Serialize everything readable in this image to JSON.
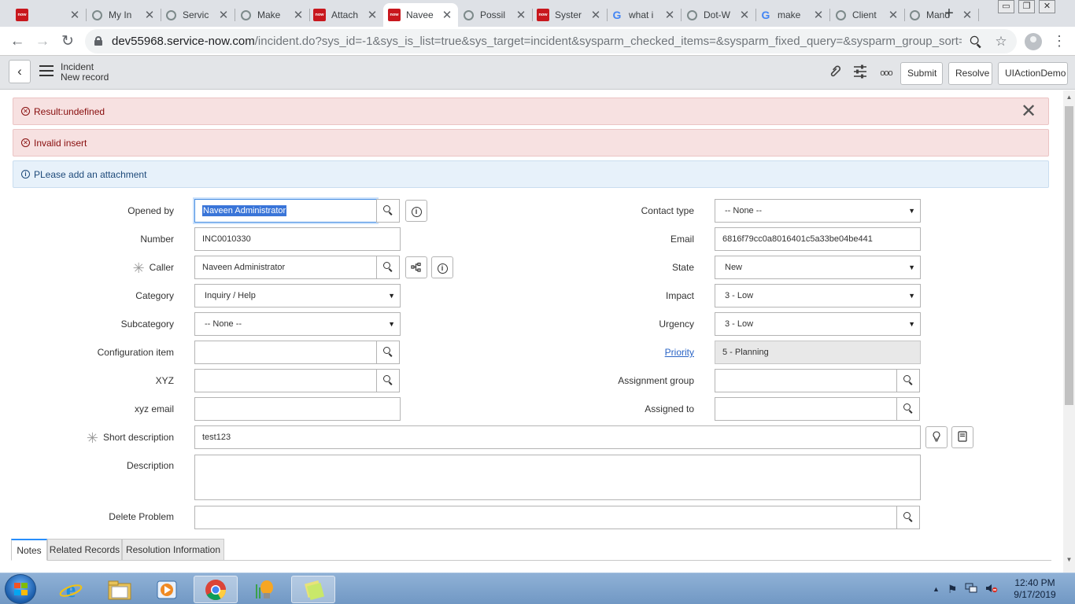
{
  "browser": {
    "tabs": [
      {
        "favicon": "now",
        "title": "",
        "active": false
      },
      {
        "favicon": "servicenow",
        "title": "My In",
        "active": false
      },
      {
        "favicon": "servicenow",
        "title": "Servic",
        "active": false
      },
      {
        "favicon": "servicenow",
        "title": "Make",
        "active": false
      },
      {
        "favicon": "now",
        "title": "Attach",
        "active": false
      },
      {
        "favicon": "now",
        "title": "Navee",
        "active": true
      },
      {
        "favicon": "servicenow",
        "title": "Possil",
        "active": false
      },
      {
        "favicon": "now",
        "title": "Syster",
        "active": false
      },
      {
        "favicon": "google",
        "title": "what i",
        "active": false
      },
      {
        "favicon": "servicenow",
        "title": "Dot-W",
        "active": false
      },
      {
        "favicon": "google",
        "title": "make",
        "active": false
      },
      {
        "favicon": "servicenow",
        "title": "Client",
        "active": false
      },
      {
        "favicon": "servicenow",
        "title": "Mand",
        "active": false
      }
    ],
    "favicon_now_text": "now",
    "new_tab_symbol": "+",
    "close_symbol": "✕",
    "window_buttons": [
      "▭",
      "❐",
      "✕"
    ],
    "url_host": "dev55968.service-now.com",
    "url_path": "/incident.do?sys_id=-1&sys_is_list=true&sys_target=incident&sysparm_checked_items=&sysparm_fixed_query=&sysparm_group_sort=&sysparm...",
    "nav_icons": {
      "back": "←",
      "forward": "→",
      "reload": "↻",
      "zoom": "zoom-icon",
      "star": "☆",
      "menu": "⋮"
    }
  },
  "header": {
    "back_symbol": "‹",
    "title": "Incident",
    "subtitle": "New record",
    "buttons": [
      "Submit",
      "Resolve",
      "UIActionDemo"
    ],
    "icons": {
      "attachment": "📎",
      "settings": "☰",
      "more": "ooo"
    }
  },
  "alerts": [
    {
      "type": "error",
      "text": "Result:undefined"
    },
    {
      "type": "error",
      "text": "Invalid insert"
    },
    {
      "type": "info",
      "text": "PLease add an attachment"
    }
  ],
  "alert_icons": {
    "error": "✕",
    "info": "i",
    "close": "✕"
  },
  "form": {
    "opened_by": {
      "label": "Opened by",
      "value": "Naveen Administrator"
    },
    "number": {
      "label": "Number",
      "value": "INC0010330"
    },
    "caller": {
      "label": "Caller",
      "value": "Naveen Administrator",
      "mandatory_mark": "✳"
    },
    "category": {
      "label": "Category",
      "value": "Inquiry / Help"
    },
    "subcategory": {
      "label": "Subcategory",
      "value": "-- None --"
    },
    "configuration_item": {
      "label": "Configuration item",
      "value": ""
    },
    "xyz": {
      "label": "XYZ",
      "value": ""
    },
    "xyz_email": {
      "label": "xyz email",
      "value": ""
    },
    "short_description": {
      "label": "Short description",
      "value": "test123",
      "mandatory_mark": "✳"
    },
    "description": {
      "label": "Description",
      "value": ""
    },
    "delete_problem": {
      "label": "Delete Problem",
      "value": ""
    },
    "contact_type": {
      "label": "Contact type",
      "value": "-- None --"
    },
    "email": {
      "label": "Email",
      "value": "6816f79cc0a8016401c5a33be04be441"
    },
    "state": {
      "label": "State",
      "value": "New"
    },
    "impact": {
      "label": "Impact",
      "value": "3 - Low"
    },
    "urgency": {
      "label": "Urgency",
      "value": "3 - Low"
    },
    "priority": {
      "label": "Priority",
      "value": "5 - Planning"
    },
    "assignment_group": {
      "label": "Assignment group",
      "value": ""
    },
    "assigned_to": {
      "label": "Assigned to",
      "value": ""
    }
  },
  "section_tabs": [
    "Notes",
    "Related Records",
    "Resolution Information"
  ],
  "taskbar": {
    "apps": [
      "internet-explorer",
      "file-explorer",
      "media-player",
      "chrome",
      "paint",
      "sticky-notes"
    ],
    "time": "12:40 PM",
    "date": "9/17/2019",
    "tray_icons": {
      "up": "▲",
      "flag": "⚑",
      "network": "network-icon",
      "volume": "volume-icon"
    }
  },
  "colors": {
    "error_bg": "#f7e1e1",
    "info_bg": "#e7f1fa",
    "link": "#2a64c5",
    "selection": "#3a75d8",
    "servicenow_red": "#c8171d"
  }
}
